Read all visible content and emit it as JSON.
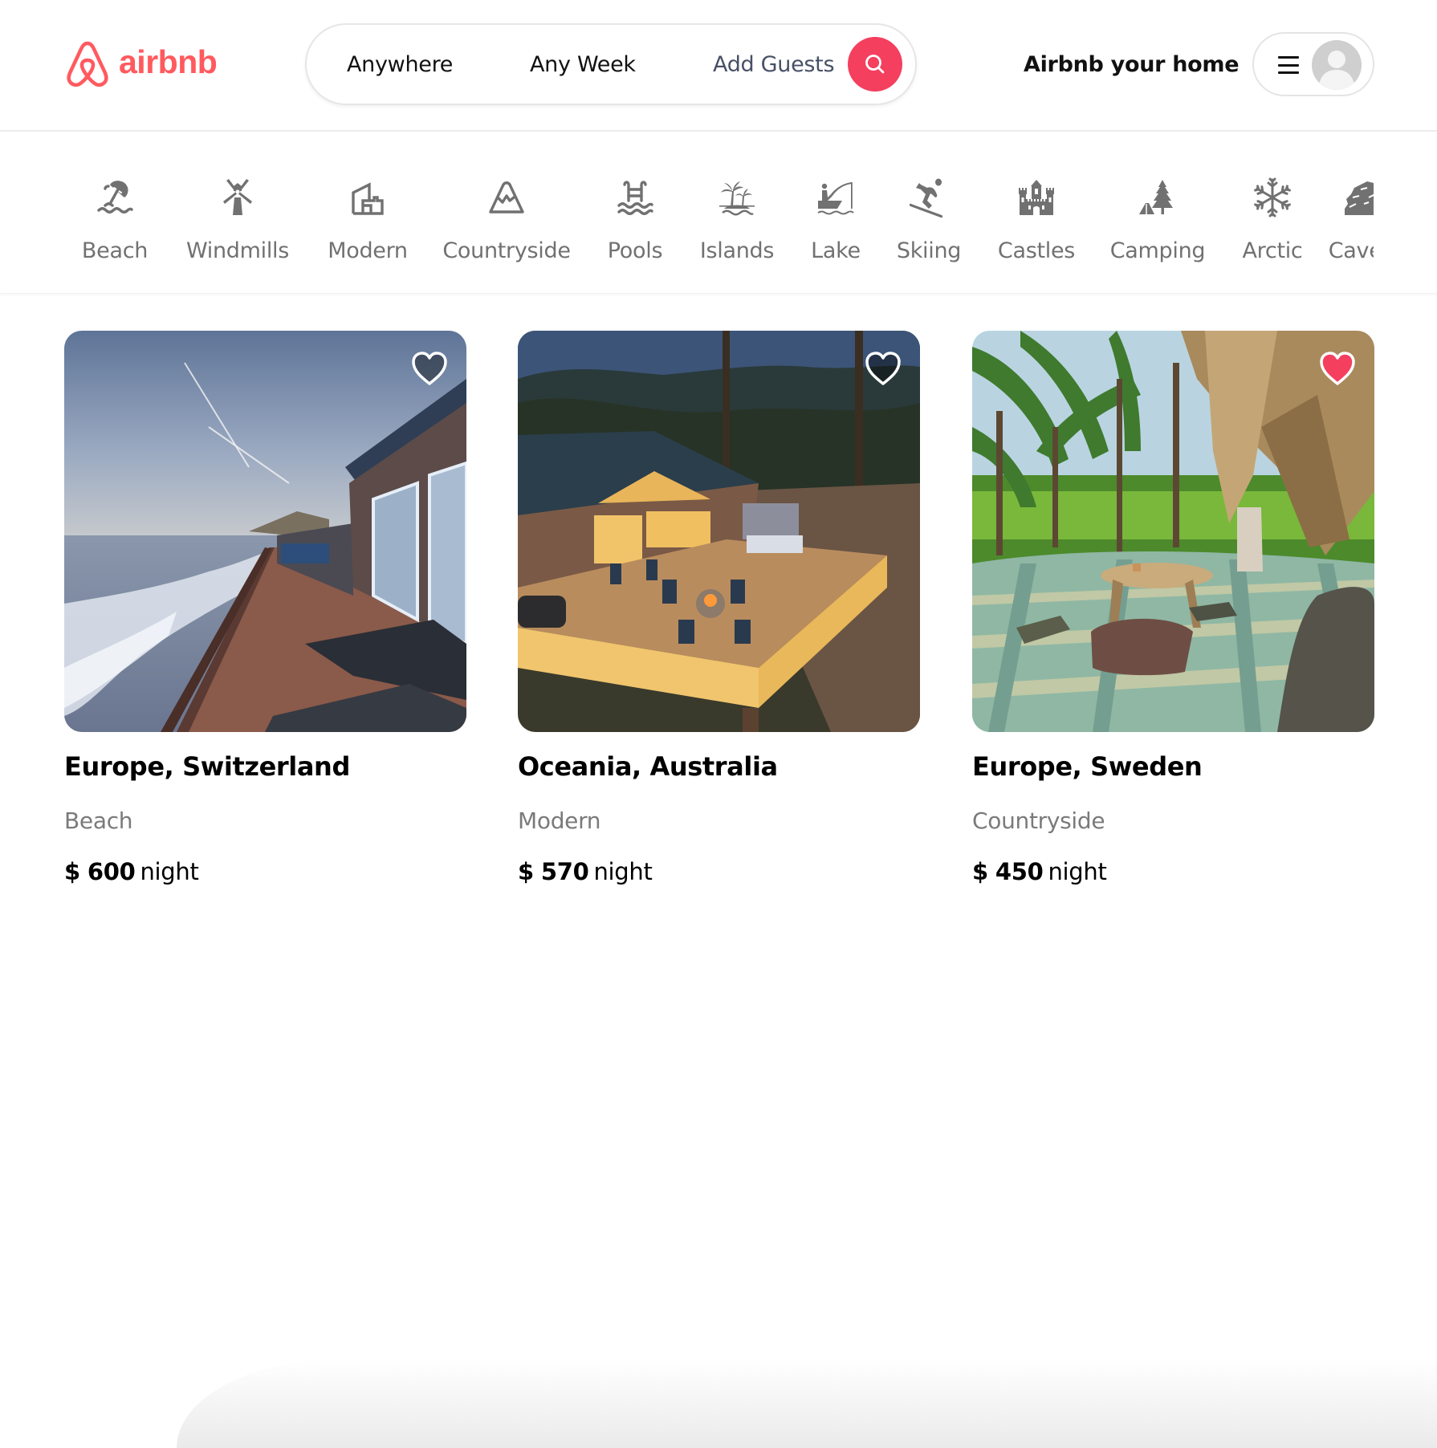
{
  "brand": {
    "name": "airbnb",
    "color": "#ff5a5f",
    "logo_icon": "airbnb-belo-icon"
  },
  "search": {
    "where_label": "Anywhere",
    "when_label": "Any Week",
    "guests_label": "Add Guests",
    "button_icon": "search-icon",
    "button_color": "#f43f5e"
  },
  "header": {
    "host_link": "Airbnb your home",
    "menu_icon": "hamburger-menu-icon",
    "avatar_icon": "user-avatar-placeholder"
  },
  "categories": [
    {
      "label": "Beach",
      "icon": "beach-umbrella-icon"
    },
    {
      "label": "Windmills",
      "icon": "windmill-icon"
    },
    {
      "label": "Modern",
      "icon": "modern-building-icon"
    },
    {
      "label": "Countryside",
      "icon": "mountain-icon"
    },
    {
      "label": "Pools",
      "icon": "pool-ladder-icon"
    },
    {
      "label": "Islands",
      "icon": "island-palm-icon"
    },
    {
      "label": "Lake",
      "icon": "fishing-boat-icon"
    },
    {
      "label": "Skiing",
      "icon": "skier-icon"
    },
    {
      "label": "Castles",
      "icon": "castle-icon"
    },
    {
      "label": "Camping",
      "icon": "tent-tree-icon"
    },
    {
      "label": "Arctic",
      "icon": "snowflake-icon"
    },
    {
      "label": "Caves",
      "icon": "cave-icon"
    }
  ],
  "listings": [
    {
      "title": "Europe, Switzerland",
      "category": "Beach",
      "currency": "$",
      "price": "600",
      "unit": "night",
      "favorited": false,
      "image_alt": "Oceanfront wooden deck with sea waves at sunset"
    },
    {
      "title": "Oceania, Australia",
      "category": "Modern",
      "currency": "$",
      "price": "570",
      "unit": "night",
      "favorited": false,
      "image_alt": "Cabin with lit wooden deck, hot tub and fire pit in forest"
    },
    {
      "title": "Europe, Sweden",
      "category": "Countryside",
      "currency": "$",
      "price": "450",
      "unit": "night",
      "favorited": true,
      "image_alt": "Tiled patio with low table and floor cushions under thatched roof among palm trees"
    }
  ],
  "colors": {
    "text_primary": "#000000",
    "text_secondary": "#717171",
    "heart_active": "#f43f5e",
    "border": "#e6e6e6"
  }
}
